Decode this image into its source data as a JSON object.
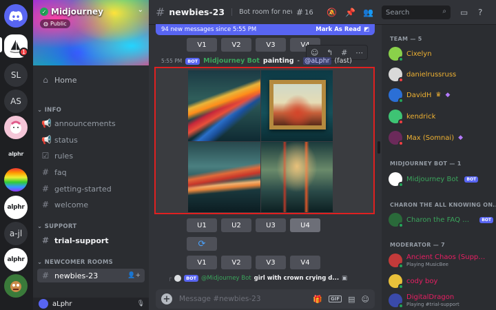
{
  "server": {
    "name": "Midjourney",
    "visibility": "Public"
  },
  "rail": {
    "items": [
      {
        "label": "SL"
      },
      {
        "label": "AS"
      },
      {
        "label": "alphr"
      },
      {
        "label": "alphr"
      },
      {
        "label": "a-jl"
      },
      {
        "label": "alphr"
      }
    ],
    "badge": "1"
  },
  "channels": {
    "home": "Home",
    "categories": {
      "info": "INFO",
      "support": "SUPPORT",
      "newcomer": "NEWCOMER ROOMS"
    },
    "info_items": [
      "announcements",
      "status",
      "rules",
      "faq",
      "getting-started",
      "welcome"
    ],
    "support_item": "trial-support",
    "newcomer_item": "newbies-23"
  },
  "user": {
    "name": "aLphr"
  },
  "header": {
    "channel": "newbies-23",
    "topic": "Bot room for new u...",
    "thread_count": "16",
    "search_placeholder": "Search"
  },
  "new_messages": {
    "text": "94 new messages since 5:55 PM",
    "action": "Mark As Read"
  },
  "message": {
    "time": "5:55 PM",
    "bot_tag": "BOT",
    "author": "Midjourney Bot",
    "prompt": "painting",
    "separator": " - ",
    "mention": "@aLphr",
    "speed": "(fast)"
  },
  "buttons": {
    "top_row": [
      "V1",
      "V2",
      "V3",
      "V4"
    ],
    "upscale_row": [
      "U1",
      "U2",
      "U3",
      "U4"
    ],
    "variation_row": [
      "V1",
      "V2",
      "V3",
      "V4"
    ]
  },
  "next_message": {
    "bot_tag": "BOT",
    "author": "@Midjourney Bot",
    "text": "girl with crown crying d..."
  },
  "composer": {
    "placeholder": "Message #newbies-23",
    "gif_label": "GIF"
  },
  "members": {
    "groups": [
      {
        "title": "TEAM — 5",
        "members": [
          {
            "name": "Cixelyn",
            "color": "#f0b232"
          },
          {
            "name": "danielrussruss",
            "color": "#f0b232"
          },
          {
            "name": "DavidH",
            "color": "#f0b232"
          },
          {
            "name": "kendrick",
            "color": "#f0b232"
          },
          {
            "name": "Max (Somnai)",
            "color": "#f0b232"
          }
        ]
      },
      {
        "title": "MIDJOURNEY BOT — 1",
        "members": [
          {
            "name": "Midjourney Bot",
            "color": "#3ba55c",
            "tag": "BOT"
          }
        ]
      },
      {
        "title": "CHARON THE ALL KNOWING ON...",
        "members": [
          {
            "name": "Charon the FAQ Bot",
            "color": "#3ba55c",
            "tag": "BOT"
          }
        ]
      },
      {
        "title": "MODERATOR — 7",
        "members": [
          {
            "name": "Ancient Chaos (Suppo...",
            "color": "#e91e63",
            "activity": "Playing MusicBee"
          },
          {
            "name": "cody boy",
            "color": "#e91e63"
          },
          {
            "name": "DigitalDragon",
            "color": "#e91e63",
            "activity": "Playing #trial-support"
          }
        ]
      }
    ]
  },
  "colors": {
    "accent": "#5865f2",
    "highlight_border": "#e02020",
    "online": "#23a55a"
  }
}
